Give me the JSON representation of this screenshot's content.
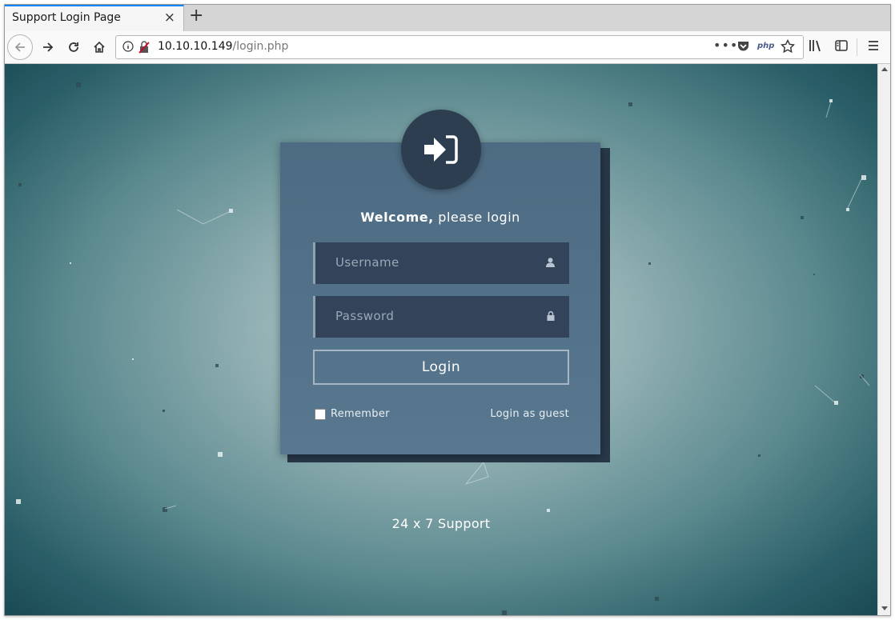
{
  "browser": {
    "tab_title": "Support Login Page",
    "tab_close": "×",
    "new_tab": "+",
    "url_host": "10.10.10.149",
    "url_path": "/login.php",
    "page_actions": "•••",
    "php_badge": "php",
    "icons": [
      "back-icon",
      "forward-icon",
      "reload-icon",
      "home-icon",
      "info-icon",
      "insecure-lock-icon",
      "pocket-icon",
      "star-icon",
      "library-icon",
      "sidebar-icon",
      "menu-icon"
    ]
  },
  "login": {
    "welcome_bold": "Welcome,",
    "welcome_rest": " please login",
    "username_placeholder": "Username",
    "password_placeholder": "Password",
    "login_button": "Login",
    "remember_label": "Remember",
    "guest_link": "Login as guest",
    "support_text": "24 x 7 Support"
  },
  "colors": {
    "card": "#587890",
    "avatar": "#2d3e50",
    "field": "#33435a",
    "accent": "#0a84ff"
  }
}
